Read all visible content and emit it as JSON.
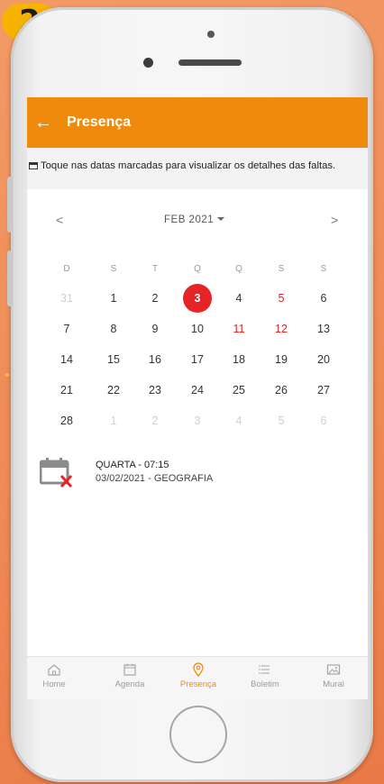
{
  "step_badge": "2",
  "app": {
    "title": "Presença",
    "back_icon": "arrow-left-icon",
    "accent_color": "#f08a0c",
    "absence_color": "#e52428"
  },
  "notice": {
    "icon": "calendar-icon",
    "text": "Toque nas datas marcadas para visualizar os detalhes das faltas."
  },
  "calendar": {
    "prev_label": "<",
    "next_label": ">",
    "month_label": "FEB 2021",
    "weekday_labels": [
      "D",
      "S",
      "T",
      "Q",
      "Q",
      "S",
      "S"
    ],
    "weeks": [
      [
        {
          "d": "31",
          "s": "muted"
        },
        {
          "d": "1",
          "s": ""
        },
        {
          "d": "2",
          "s": ""
        },
        {
          "d": "3",
          "s": "sel"
        },
        {
          "d": "4",
          "s": ""
        },
        {
          "d": "5",
          "s": "red"
        },
        {
          "d": "6",
          "s": ""
        }
      ],
      [
        {
          "d": "7",
          "s": ""
        },
        {
          "d": "8",
          "s": ""
        },
        {
          "d": "9",
          "s": ""
        },
        {
          "d": "10",
          "s": ""
        },
        {
          "d": "11",
          "s": "red"
        },
        {
          "d": "12",
          "s": "red"
        },
        {
          "d": "13",
          "s": ""
        }
      ],
      [
        {
          "d": "14",
          "s": ""
        },
        {
          "d": "15",
          "s": ""
        },
        {
          "d": "16",
          "s": ""
        },
        {
          "d": "17",
          "s": ""
        },
        {
          "d": "18",
          "s": ""
        },
        {
          "d": "19",
          "s": ""
        },
        {
          "d": "20",
          "s": ""
        }
      ],
      [
        {
          "d": "21",
          "s": ""
        },
        {
          "d": "22",
          "s": ""
        },
        {
          "d": "23",
          "s": ""
        },
        {
          "d": "24",
          "s": ""
        },
        {
          "d": "25",
          "s": ""
        },
        {
          "d": "26",
          "s": ""
        },
        {
          "d": "27",
          "s": ""
        }
      ],
      [
        {
          "d": "28",
          "s": ""
        },
        {
          "d": "1",
          "s": "muted"
        },
        {
          "d": "2",
          "s": "muted"
        },
        {
          "d": "3",
          "s": "muted"
        },
        {
          "d": "4",
          "s": "muted"
        },
        {
          "d": "5",
          "s": "muted"
        },
        {
          "d": "6",
          "s": "muted"
        }
      ]
    ]
  },
  "absence": {
    "icon": "calendar-absence-icon",
    "title": "QUARTA - 07:15",
    "detail": "03/02/2021 - GEOGRAFIA"
  },
  "tabs": [
    {
      "label": "Home",
      "icon": "home-icon",
      "active": false
    },
    {
      "label": "Agenda",
      "icon": "agenda-icon",
      "active": false
    },
    {
      "label": "Presença",
      "icon": "location-pin-icon",
      "active": true
    },
    {
      "label": "Boletim",
      "icon": "list-icon",
      "active": false
    },
    {
      "label": "Mural",
      "icon": "image-icon",
      "active": false
    }
  ]
}
